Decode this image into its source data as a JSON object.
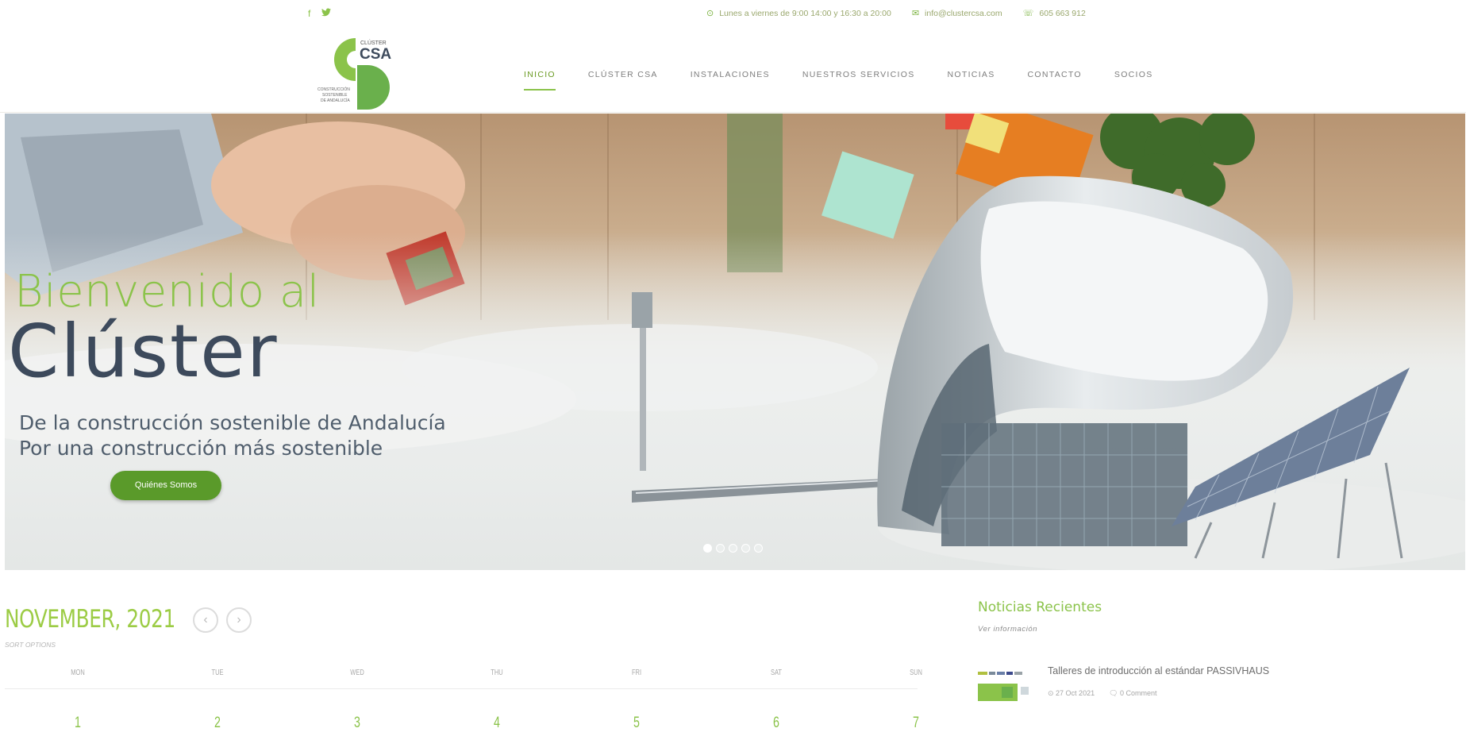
{
  "topbar": {
    "social": [
      {
        "icon": "facebook-icon",
        "glyph": "f"
      },
      {
        "icon": "twitter-icon",
        "glyph": "🐦"
      }
    ],
    "hours": "Lunes a viernes de 9:00 14:00 y 16:30 a 20:00",
    "email": "info@clustercsa.com",
    "phone": "605 663 912"
  },
  "logo": {
    "top_text": "CLÚSTER",
    "brand": "CSA",
    "subtitle": [
      "CONSTRUCCIÓN",
      "SOSTENIBLE",
      "DE ANDALUCÍA"
    ]
  },
  "nav": {
    "items": [
      "INICIO",
      "CLÚSTER CSA",
      "INSTALACIONES",
      "NUESTROS SERVICIOS",
      "NOTICIAS",
      "CONTACTO",
      "SOCIOS"
    ],
    "active_index": 0
  },
  "hero": {
    "title_line1": "Bienvenido al",
    "title_line2": "Clúster",
    "subtitle_line1": "De la construcción sostenible de Andalucía",
    "subtitle_line2": "Por una construcción más sostenible",
    "button_label": "Quiénes Somos",
    "slides_count": 5,
    "active_slide": 0
  },
  "calendar": {
    "month_title": "NOVEMBER, 2021",
    "prev_glyph": "‹",
    "next_glyph": "›",
    "sort_label": "SORT OPTIONS",
    "weekdays": [
      "MON",
      "TUE",
      "WED",
      "THU",
      "FRI",
      "SAT",
      "SUN"
    ],
    "first_week": [
      "1",
      "2",
      "3",
      "4",
      "5",
      "6",
      "7"
    ]
  },
  "news": {
    "title": "Noticias Recientes",
    "more_label": "Ver información",
    "items": [
      {
        "title": "Talleres de introducción al estándar PASSIVHAUS",
        "date": "27 Oct 2021",
        "comments": "0 Comment"
      }
    ]
  },
  "colors": {
    "brand_green": "#8bc34a",
    "button_green": "#5a9a2a",
    "title_dark": "#3d4a5c"
  }
}
